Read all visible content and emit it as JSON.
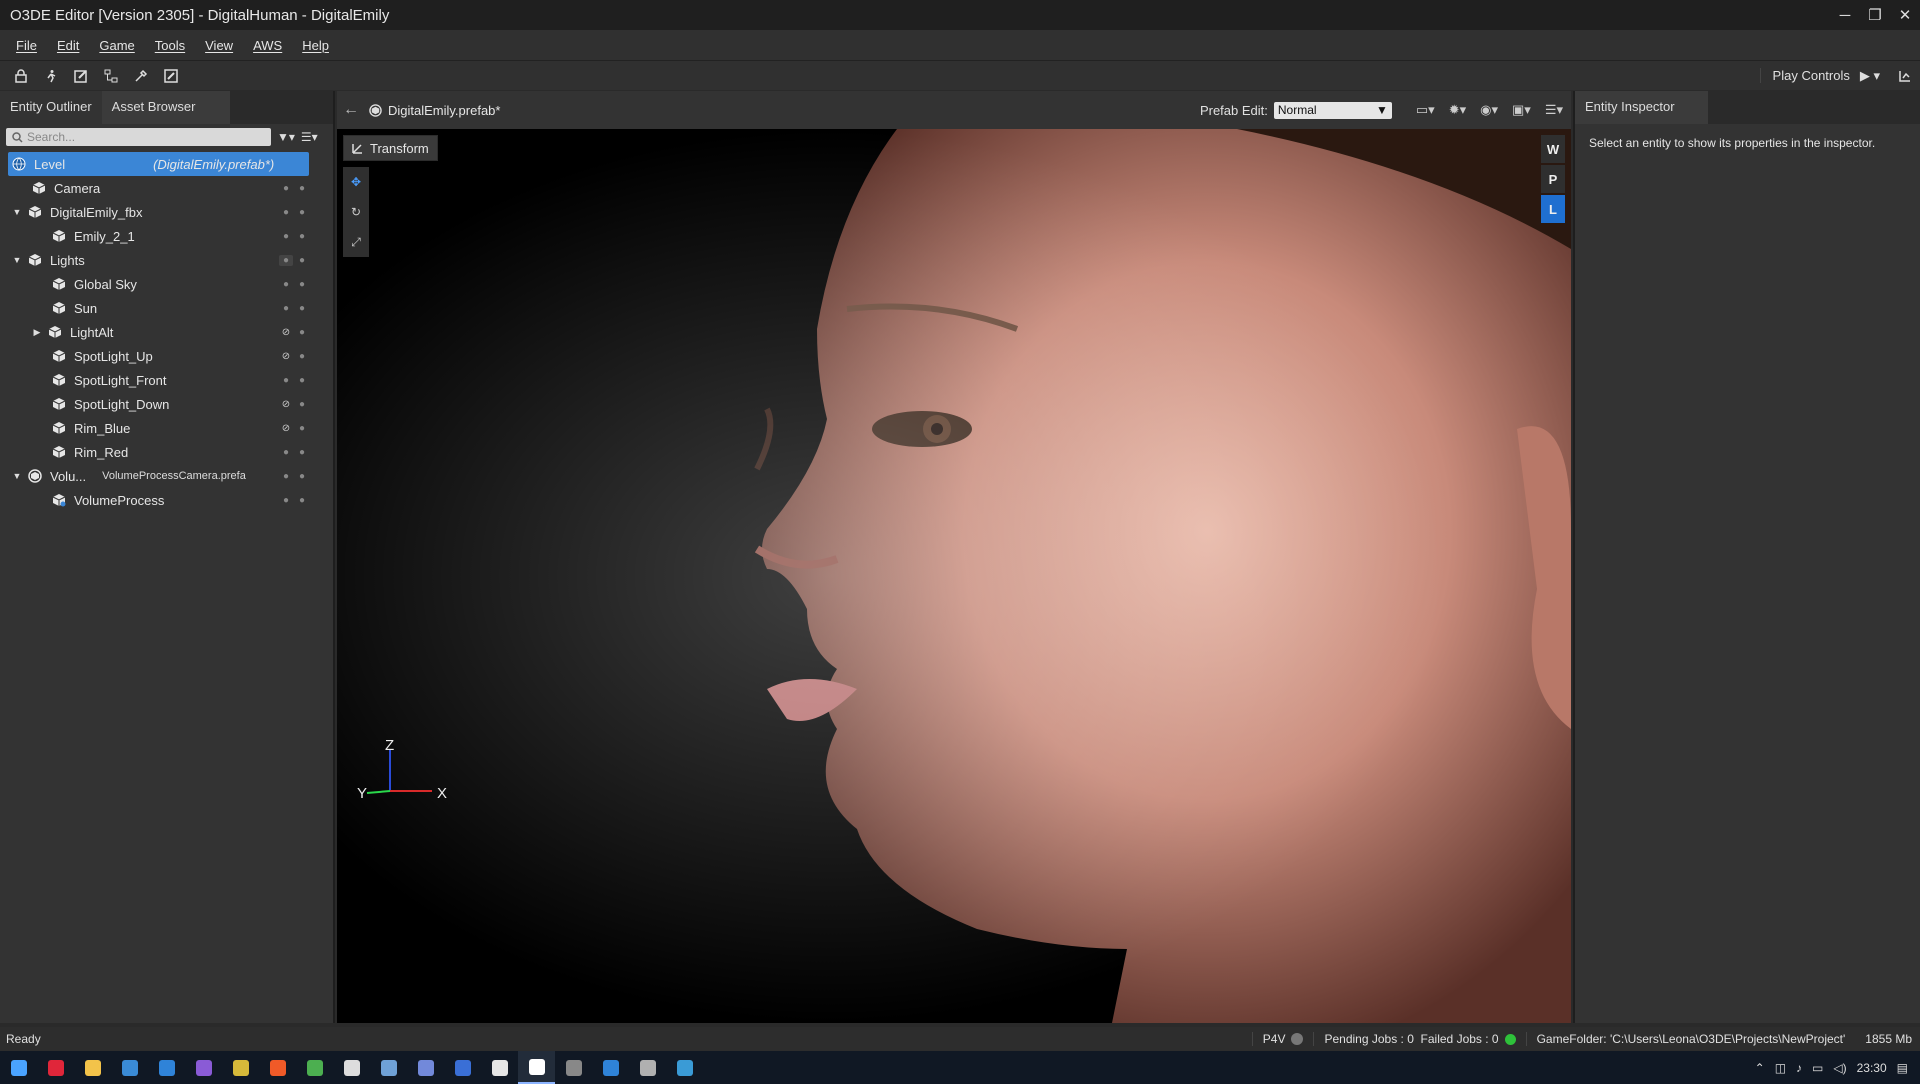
{
  "window": {
    "title": "O3DE Editor [Version 2305] - DigitalHuman - DigitalEmily",
    "controls": [
      "─",
      "❐",
      "✕"
    ]
  },
  "menu": [
    "File",
    "Edit",
    "Game",
    "Tools",
    "View",
    "AWS",
    "Help"
  ],
  "toolbar": {
    "play_controls_label": "Play Controls",
    "play_icon": "▶ ▾"
  },
  "left_panel": {
    "tabs": [
      "Entity Outliner",
      "Asset Browser"
    ],
    "search_placeholder": "Search...",
    "tree": {
      "level_label": "Level",
      "level_prefab": "(DigitalEmily.prefab*)",
      "items": [
        {
          "label": "Camera",
          "icon": "entity-icon"
        },
        {
          "label": "DigitalEmily_fbx",
          "icon": "entity-icon"
        },
        {
          "label": "Emily_2_1",
          "icon": "entity-icon"
        },
        {
          "label": "Lights",
          "icon": "entity-icon"
        },
        {
          "label": "Global Sky",
          "icon": "entity-icon"
        },
        {
          "label": "Sun",
          "icon": "entity-icon"
        },
        {
          "label": "LightAlt",
          "icon": "entity-icon"
        },
        {
          "label": "SpotLight_Up",
          "icon": "entity-icon"
        },
        {
          "label": "SpotLight_Front",
          "icon": "entity-icon"
        },
        {
          "label": "SpotLight_Down",
          "icon": "entity-icon"
        },
        {
          "label": "Rim_Blue",
          "icon": "entity-icon"
        },
        {
          "label": "Rim_Red",
          "icon": "entity-icon"
        },
        {
          "label": "Volu...",
          "sublabel": "VolumeProcessCamera.prefa",
          "icon": "prefab-icon"
        },
        {
          "label": "VolumeProcess",
          "icon": "entity-icon"
        }
      ]
    }
  },
  "viewport": {
    "document": "DigitalEmily.prefab*",
    "prefab_edit_label": "Prefab Edit:",
    "prefab_edit_value": "Normal",
    "transform_label": "Transform",
    "space_buttons": [
      "W",
      "P",
      "L"
    ],
    "axes": {
      "z": "Z",
      "y": "Y",
      "x": "X"
    }
  },
  "right_panel": {
    "tab": "Entity Inspector",
    "hint": "Select an entity to show its properties in the inspector."
  },
  "statusbar": {
    "status": "Ready",
    "p4v": "P4V",
    "jobs": "Pending Jobs : 0  Failed Jobs : 0",
    "game_folder": "GameFolder: 'C:\\Users\\Leona\\O3DE\\Projects\\NewProject'",
    "memory": "1855 Mb"
  },
  "taskbar": {
    "time": "23:30",
    "apps": [
      {
        "name": "windows-start",
        "color": "#4aa3ff"
      },
      {
        "name": "opera",
        "color": "#e0263a"
      },
      {
        "name": "file-explorer",
        "color": "#f3c34a"
      },
      {
        "name": "store",
        "color": "#3a8bd6"
      },
      {
        "name": "mail",
        "color": "#2f83d8"
      },
      {
        "name": "visual-studio",
        "color": "#8a5bd6"
      },
      {
        "name": "paint",
        "color": "#d6b93a"
      },
      {
        "name": "brave",
        "color": "#f05a28"
      },
      {
        "name": "app-green",
        "color": "#4caf50"
      },
      {
        "name": "notion",
        "color": "#dddddd"
      },
      {
        "name": "steam",
        "color": "#6fa1d6"
      },
      {
        "name": "discord",
        "color": "#7289da"
      },
      {
        "name": "app-blue",
        "color": "#3a6fd6"
      },
      {
        "name": "notes",
        "color": "#e6e6e6"
      },
      {
        "name": "o3de",
        "color": "#ffffff"
      },
      {
        "name": "app-grey",
        "color": "#888888"
      },
      {
        "name": "terminal",
        "color": "#2f83d8"
      },
      {
        "name": "game",
        "color": "#b0b0b0"
      },
      {
        "name": "photos",
        "color": "#3a9bd6"
      }
    ]
  },
  "colors": {
    "selection": "#3b86d6",
    "accent": "#1f6fd0"
  }
}
